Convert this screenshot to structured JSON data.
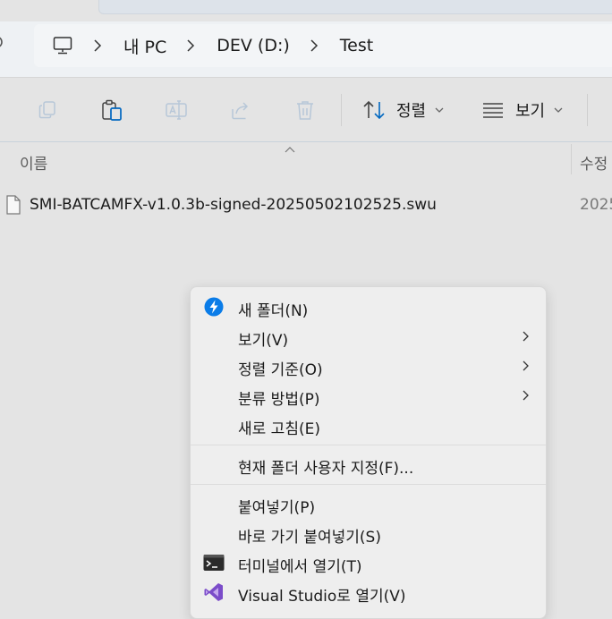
{
  "address_bar": {
    "crumbs": [
      "내 PC",
      "DEV (D:)",
      "Test"
    ]
  },
  "toolbar": {
    "sort_label": "정렬",
    "view_label": "보기"
  },
  "file_list": {
    "columns": {
      "name": "이름",
      "modified": "수정"
    },
    "files": [
      {
        "name": "SMI-BATCAMFX-v1.0.3b-signed-20250502102525.swu",
        "modified": "2025"
      }
    ]
  },
  "context_menu": {
    "items": [
      {
        "label": "새 폴더(N)",
        "icon": "new-folder-icon"
      },
      {
        "label": "보기(V)",
        "submenu": true
      },
      {
        "label": "정렬 기준(O)",
        "submenu": true
      },
      {
        "label": "분류 방법(P)",
        "submenu": true
      },
      {
        "label": "새로 고침(E)"
      },
      {
        "label": "현재 폴더 사용자 지정(F)..."
      },
      {
        "label": "붙여넣기(P)"
      },
      {
        "label": "바로 가기 붙여넣기(S)"
      },
      {
        "label": "터미널에서 열기(T)",
        "icon": "terminal-icon"
      },
      {
        "label": "Visual Studio로 열기(V)",
        "icon": "visual-studio-icon"
      }
    ]
  },
  "colors": {
    "accent": "#0067c0",
    "vs_purple": "#7b4cc9",
    "disabled_icon": "#b7c7d8"
  }
}
